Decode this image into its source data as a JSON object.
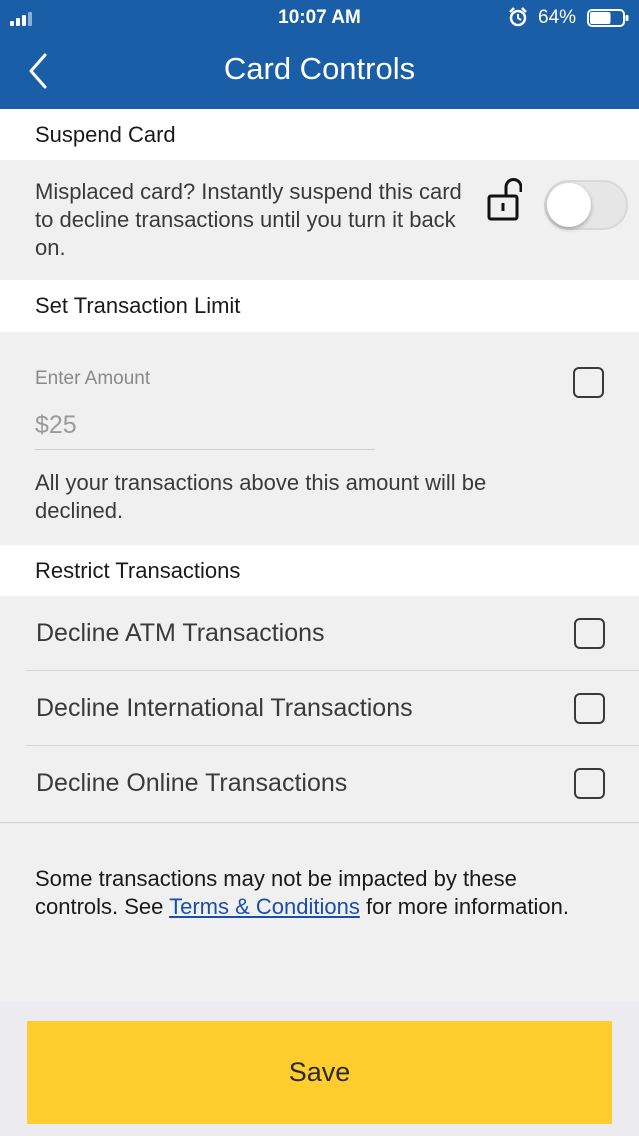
{
  "status_bar": {
    "time": "10:07 AM",
    "battery_percent": "64%",
    "battery_level": 0.64
  },
  "header": {
    "title": "Card Controls"
  },
  "suspend": {
    "section_title": "Suspend Card",
    "description": "Misplaced card? Instantly suspend this card to decline transactions until you turn it back on.",
    "toggle_on": false
  },
  "limit": {
    "section_title": "Set Transaction Limit",
    "amount_label": "Enter Amount",
    "amount_placeholder": "$25",
    "note": "All your transactions above this amount will be declined.",
    "checked": false
  },
  "restrict": {
    "section_title": "Restrict Transactions",
    "options": [
      {
        "label": "Decline ATM Transactions",
        "checked": false
      },
      {
        "label": "Decline International Transactions",
        "checked": false
      },
      {
        "label": "Decline Online Transactions",
        "checked": false
      }
    ]
  },
  "disclaimer": {
    "before": "Some transactions may not be impacted by these controls. See ",
    "link": "Terms & Conditions",
    "after": " for more information."
  },
  "actions": {
    "save_label": "Save"
  },
  "colors": {
    "header_bg": "#1a5ea8",
    "save_bg": "#ffcd2e",
    "link": "#1a4fa8"
  }
}
